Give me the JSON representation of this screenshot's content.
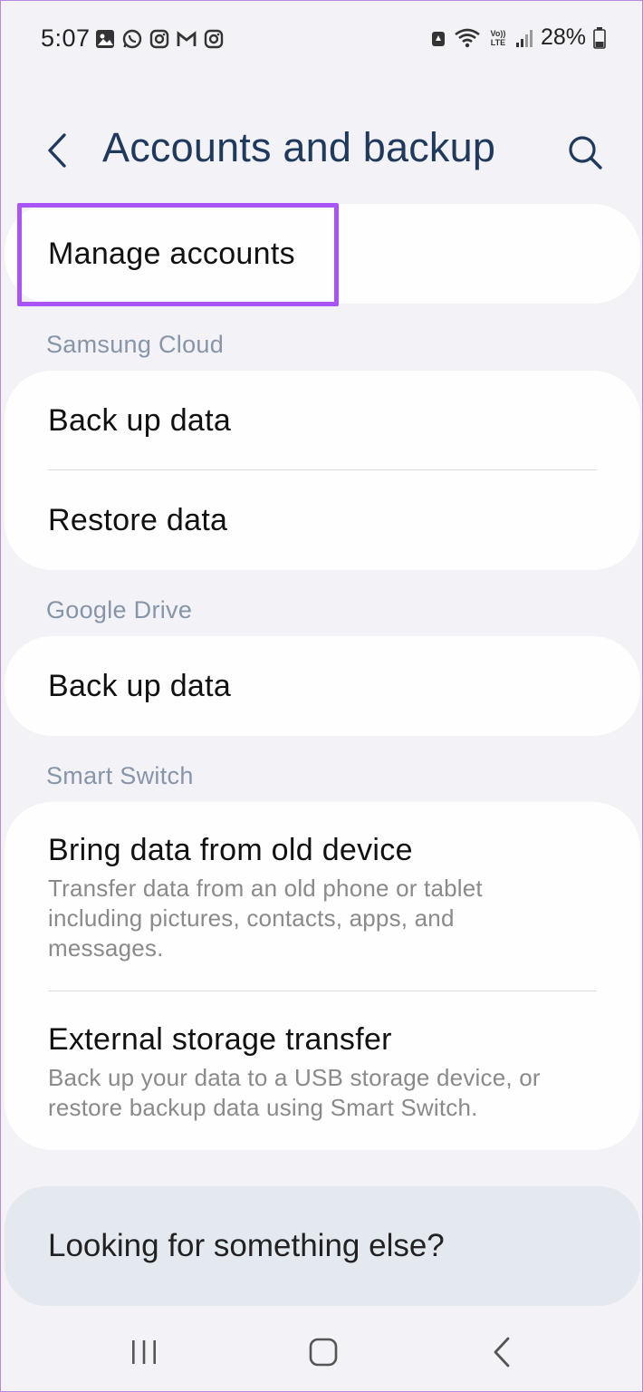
{
  "status_bar": {
    "time": "5:07",
    "battery_percent": "28%",
    "left_icons": [
      "gallery-icon",
      "whatsapp-icon",
      "instagram-icon",
      "gmail-icon",
      "instagram-icon"
    ],
    "right_icons": [
      "lock-icon",
      "wifi-icon",
      "volte-icon",
      "signal-icon",
      "battery-icon"
    ],
    "volte_label": "Vo)) LTE"
  },
  "header": {
    "title": "Accounts and backup"
  },
  "manage_accounts": {
    "label": "Manage accounts"
  },
  "sections": {
    "samsung_cloud": {
      "header": "Samsung Cloud",
      "back_up": "Back up data",
      "restore": "Restore data"
    },
    "google_drive": {
      "header": "Google Drive",
      "back_up": "Back up data"
    },
    "smart_switch": {
      "header": "Smart Switch",
      "bring_data_title": "Bring data from old device",
      "bring_data_sub": "Transfer data from an old phone or tablet including pictures, contacts, apps, and messages.",
      "external_title": "External storage transfer",
      "external_sub": "Back up your data to a USB storage device, or restore backup data using Smart Switch."
    }
  },
  "footer": {
    "text": "Looking for something else?"
  },
  "colors": {
    "title": "#1f3a5c",
    "section_header": "#8795a8",
    "highlight": "#a855f7",
    "background": "#f2f2f7"
  }
}
